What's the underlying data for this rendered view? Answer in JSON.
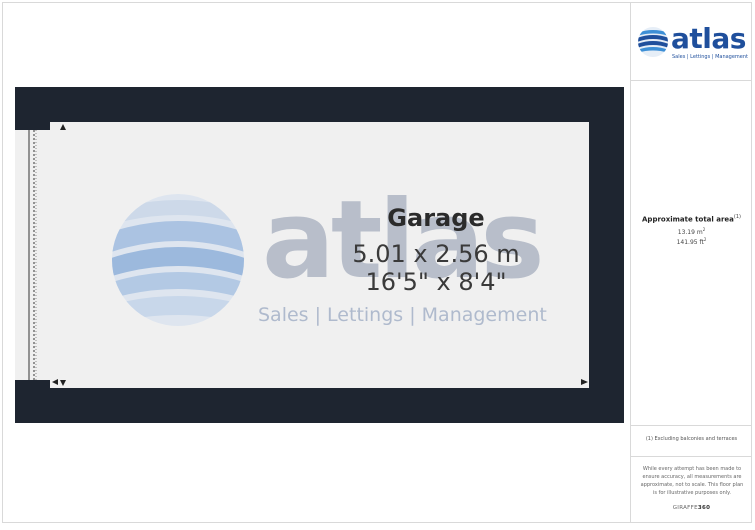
{
  "logo": {
    "word": "atlas",
    "tagline": "Sales | Lettings | Management",
    "brand_color": "#1f4f9c"
  },
  "watermark": {
    "word": "atlas",
    "tagline": "Sales | Lettings | Management"
  },
  "room": {
    "name": "Garage",
    "dim_metric": "5.01 x 2.56 m",
    "dim_imperial": "16'5\" x 8'4\""
  },
  "area": {
    "title": "Approximate total area",
    "title_marker": "(1)",
    "metric_value": "13.19 m",
    "metric_unit_sup": "2",
    "imperial_value": "141.95 ft",
    "imperial_unit_sup": "2"
  },
  "footnote": "(1) Excluding balconies and terraces",
  "disclaimer": "While every attempt has been made to ensure accuracy, all measurements are approximate, not to scale. This floor plan is for illustrative purposes only.",
  "brand": {
    "prefix": "GIRAFFE",
    "suffix": "360"
  },
  "colors": {
    "wall": "#1e2530",
    "floor": "#f0f0f0",
    "frame": "#d9d9d9"
  }
}
